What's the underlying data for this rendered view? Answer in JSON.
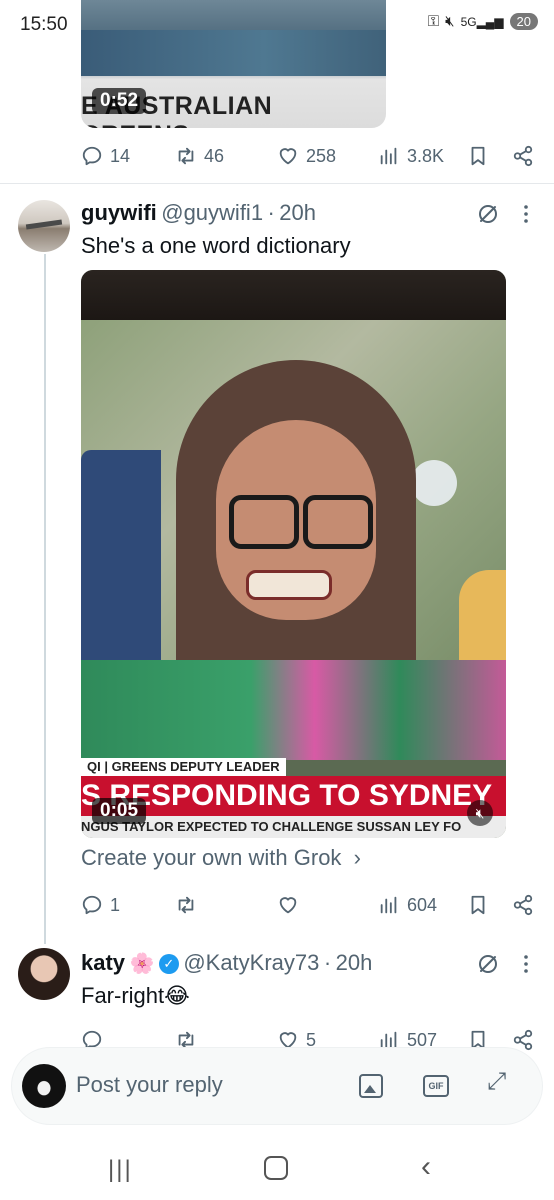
{
  "status_bar": {
    "time": "15:50",
    "battery": "20"
  },
  "prev_tweet": {
    "media_caption": "E AUSTRALIAN GREENS",
    "video_time": "0:52",
    "stats": {
      "replies": "14",
      "reposts": "46",
      "likes": "258",
      "views": "3.8K"
    }
  },
  "tweet1": {
    "name": "guywifi",
    "handle": "@guywifi1",
    "sep": "·",
    "time": "20h",
    "text": "She's a one word dictionary",
    "video": {
      "lower_third_label": "QI | GREENS DEPUTY LEADER",
      "headline": "S RESPONDING TO SYDNEY",
      "ticker": "NGUS TAYLOR EXPECTED TO CHALLENGE SUSSAN LEY FO",
      "time": "0:05"
    },
    "grok_link": "Create your own with Grok",
    "stats": {
      "replies": "1",
      "reposts": "",
      "likes": "",
      "views": "604"
    }
  },
  "tweet2": {
    "name": "katy",
    "name_emoji": "🌸",
    "handle": "@KatyKray73",
    "sep": "·",
    "time": "20h",
    "text": "Far-right",
    "text_emoji": "😂",
    "stats": {
      "replies": "",
      "reposts": "",
      "likes": "5",
      "views": "507"
    }
  },
  "reply_bar": {
    "placeholder": "Post your reply",
    "gif_label": "GIF"
  },
  "colors": {
    "accent": "#1d9bf0",
    "muted": "#536471",
    "text": "#0f1419",
    "breaking_red": "#c8102e"
  },
  "icons": [
    "reply-icon",
    "repost-icon",
    "like-icon",
    "views-icon",
    "bookmark-icon",
    "share-icon",
    "grok-icon",
    "more-icon",
    "verified-icon",
    "image-icon",
    "gif-icon",
    "expand-icon"
  ]
}
